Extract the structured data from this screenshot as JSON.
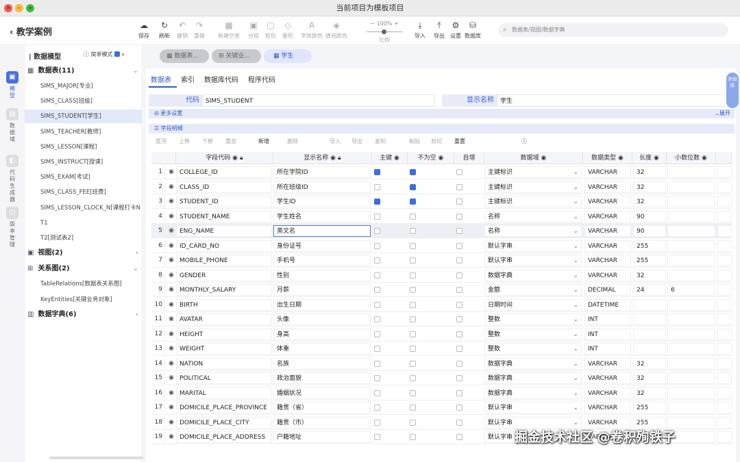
{
  "window": {
    "title": "当前项目为模板项目"
  },
  "header": {
    "back_label": "教学案例"
  },
  "toolbar": {
    "buttons": [
      {
        "label": "保存",
        "icon": "cloud-save-icon"
      },
      {
        "label": "刷新",
        "icon": "refresh-icon"
      },
      {
        "label": "撤销",
        "icon": "undo-icon"
      },
      {
        "label": "重做",
        "icon": "redo-icon"
      },
      {
        "label": "新建空表",
        "icon": "new-table-icon"
      },
      {
        "label": "分组",
        "icon": "group-icon"
      },
      {
        "label": "矩形",
        "icon": "rect-icon"
      },
      {
        "label": "菱形",
        "icon": "diamond-icon"
      },
      {
        "label": "字体颜色",
        "icon": "font-color-icon"
      },
      {
        "label": "填充颜色",
        "icon": "fill-color-icon"
      },
      {
        "label": "导入",
        "icon": "import-icon"
      },
      {
        "label": "导出",
        "icon": "export-icon"
      },
      {
        "label": "设置",
        "icon": "gear-icon"
      },
      {
        "label": "数据库",
        "icon": "database-icon"
      }
    ],
    "zoom": {
      "value": "100%",
      "label": "比例"
    },
    "search_placeholder": "数据表/视图/数据字典"
  },
  "rail": [
    {
      "label": "模型"
    },
    {
      "label": "数据域"
    },
    {
      "label": "代码生成器"
    },
    {
      "label": "版本管理"
    }
  ],
  "sidebar": {
    "title": "数据模型",
    "simple_mode": "简单模式",
    "groups": {
      "tables": "数据表(11)",
      "views": "视图(2)",
      "relations": "关系图(2)",
      "dicts": "数据字典(6)"
    },
    "tables": [
      "SIMS_MAJOR[专业]",
      "SIMS_CLASS[班级]",
      "SIMS_STUDENT[学生]",
      "SIMS_TEACHER[教师]",
      "SIMS_LESSON[课程]",
      "SIMS_INSTRUCT[授课]",
      "SIMS_EXAM[考试]",
      "SIMS_CLASS_FEE[班费]",
      "SIMS_LESSON_CLOCK_N[课程打卡N",
      "T1",
      "T2[测试表2]"
    ],
    "relations": [
      "TableRelations[数据表关系图]",
      "KeyEntities[关键业务对象]"
    ]
  },
  "doc_tabs": [
    "数据表...",
    "关键业...",
    "学生"
  ],
  "sub_tabs": [
    "数据表",
    "索引",
    "数据库代码",
    "程序代码"
  ],
  "side_pill": "字段库",
  "form": {
    "code_label": "代码",
    "code_value": "SIMS_STUDENT",
    "name_label": "显示名称",
    "name_value": "学生"
  },
  "more_settings": {
    "label": "更多设置",
    "expand": "展开"
  },
  "field_detail": {
    "label": "字段明细"
  },
  "grid_toolbar": [
    "置顶",
    "上移",
    "下移",
    "置底",
    "新增",
    "删除",
    "导入",
    "导出",
    "复制",
    "粘贴",
    "剪切",
    "重置"
  ],
  "columns": [
    "字段代码",
    "显示名称",
    "主键",
    "不为空",
    "自增",
    "数据域",
    "数据类型",
    "长度",
    "小数位数"
  ],
  "rows": [
    {
      "n": "1",
      "code": "COLLEGE_ID",
      "name": "所在学院ID",
      "pk": true,
      "nn": true,
      "ai": false,
      "domain": "主键标识",
      "type": "VARCHAR",
      "len": "32",
      "dec": ""
    },
    {
      "n": "2",
      "code": "CLASS_ID",
      "name": "所在班级ID",
      "pk": false,
      "nn": true,
      "ai": false,
      "domain": "主键标识",
      "type": "VARCHAR",
      "len": "32",
      "dec": ""
    },
    {
      "n": "3",
      "code": "STUDENT_ID",
      "name": "学生ID",
      "pk": true,
      "nn": true,
      "ai": false,
      "domain": "主键标识",
      "type": "VARCHAR",
      "len": "32",
      "dec": ""
    },
    {
      "n": "4",
      "code": "STUDENT_NAME",
      "name": "学生姓名",
      "pk": false,
      "nn": false,
      "ai": false,
      "domain": "名称",
      "type": "VARCHAR",
      "len": "90",
      "dec": ""
    },
    {
      "n": "5",
      "code": "ENG_NAME",
      "name": "英文名",
      "pk": false,
      "nn": false,
      "ai": false,
      "domain": "名称",
      "type": "VARCHAR",
      "len": "90",
      "dec": ""
    },
    {
      "n": "6",
      "code": "ID_CARD_NO",
      "name": "身份证号",
      "pk": false,
      "nn": false,
      "ai": false,
      "domain": "默认字串",
      "type": "VARCHAR",
      "len": "255",
      "dec": ""
    },
    {
      "n": "7",
      "code": "MOBILE_PHONE",
      "name": "手机号",
      "pk": false,
      "nn": false,
      "ai": false,
      "domain": "默认字串",
      "type": "VARCHAR",
      "len": "255",
      "dec": ""
    },
    {
      "n": "8",
      "code": "GENDER",
      "name": "性别",
      "pk": false,
      "nn": false,
      "ai": false,
      "domain": "数据字典",
      "type": "VARCHAR",
      "len": "32",
      "dec": ""
    },
    {
      "n": "9",
      "code": "MONTHLY_SALARY",
      "name": "月薪",
      "pk": false,
      "nn": false,
      "ai": false,
      "domain": "金额",
      "type": "DECIMAL",
      "len": "24",
      "dec": "6"
    },
    {
      "n": "10",
      "code": "BIRTH",
      "name": "出生日期",
      "pk": false,
      "nn": false,
      "ai": false,
      "domain": "日期时间",
      "type": "DATETIME",
      "len": "",
      "dec": ""
    },
    {
      "n": "11",
      "code": "AVATAR",
      "name": "头像",
      "pk": false,
      "nn": false,
      "ai": false,
      "domain": "整数",
      "type": "INT",
      "len": "",
      "dec": ""
    },
    {
      "n": "12",
      "code": "HEIGHT",
      "name": "身高",
      "pk": false,
      "nn": false,
      "ai": false,
      "domain": "整数",
      "type": "INT",
      "len": "",
      "dec": ""
    },
    {
      "n": "13",
      "code": "WEIGHT",
      "name": "体重",
      "pk": false,
      "nn": false,
      "ai": false,
      "domain": "整数",
      "type": "INT",
      "len": "",
      "dec": ""
    },
    {
      "n": "14",
      "code": "NATION",
      "name": "名族",
      "pk": false,
      "nn": false,
      "ai": false,
      "domain": "数据字典",
      "type": "VARCHAR",
      "len": "32",
      "dec": ""
    },
    {
      "n": "15",
      "code": "POLITICAL",
      "name": "政治面貌",
      "pk": false,
      "nn": false,
      "ai": false,
      "domain": "数据字典",
      "type": "VARCHAR",
      "len": "32",
      "dec": ""
    },
    {
      "n": "16",
      "code": "MARITAL",
      "name": "婚姻状况",
      "pk": false,
      "nn": false,
      "ai": false,
      "domain": "数据字典",
      "type": "VARCHAR",
      "len": "32",
      "dec": ""
    },
    {
      "n": "17",
      "code": "DOMICILE_PLACE_PROVINCE",
      "name": "籍贯（省）",
      "pk": false,
      "nn": false,
      "ai": false,
      "domain": "默认字串",
      "type": "VARCHAR",
      "len": "255",
      "dec": ""
    },
    {
      "n": "18",
      "code": "DOMICILE_PLACE_CITY",
      "name": "籍贯（市）",
      "pk": false,
      "nn": false,
      "ai": false,
      "domain": "默认字串",
      "type": "VARCHAR",
      "len": "255",
      "dec": ""
    },
    {
      "n": "19",
      "code": "DOMICILE_PLACE_ADDRESS",
      "name": "户籍地址",
      "pk": false,
      "nn": false,
      "ai": false,
      "domain": "默认字串",
      "type": "VARCHAR",
      "len": "255",
      "dec": ""
    }
  ],
  "watermark": "掘金技术社区 @卷积殉铁子"
}
